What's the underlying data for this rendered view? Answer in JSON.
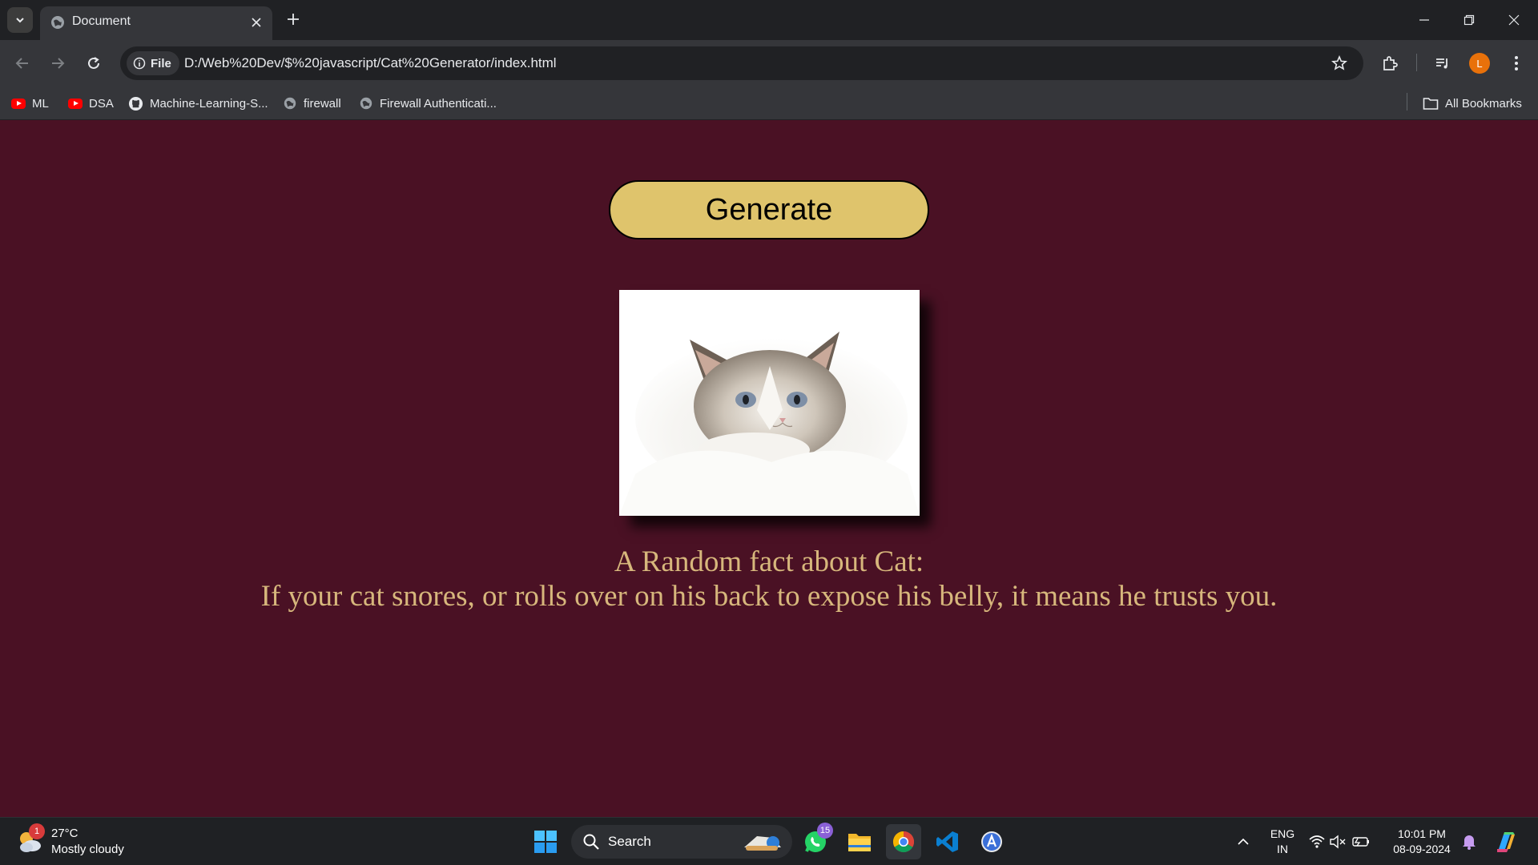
{
  "browser": {
    "tab_title": "Document",
    "chip_label": "File",
    "url": "D:/Web%20Dev/$%20javascript/Cat%20Generator/index.html",
    "profile_initial": "L",
    "bookmarks": [
      {
        "label": "ML",
        "icon": "youtube-icon"
      },
      {
        "label": "DSA",
        "icon": "youtube-icon"
      },
      {
        "label": "Machine-Learning-S...",
        "icon": "github-icon"
      },
      {
        "label": "firewall",
        "icon": "globe-icon"
      },
      {
        "label": "Firewall Authenticati...",
        "icon": "globe-icon"
      }
    ],
    "all_bookmarks_label": "All Bookmarks"
  },
  "page": {
    "generate_label": "Generate",
    "fact_heading": "A Random fact about Cat:",
    "fact_text": "If your cat snores, or rolls over on his back to expose his belly, it means he trusts you.",
    "colors": {
      "background": "#4a1124",
      "button": "#dfc46c",
      "text": "#d7b77c"
    }
  },
  "taskbar": {
    "weather_temp": "27°C",
    "weather_cond": "Mostly cloudy",
    "weather_badge": "1",
    "search_label": "Search",
    "whatsapp_badge": "15",
    "lang_top": "ENG",
    "lang_bottom": "IN",
    "time": "10:01 PM",
    "date": "08-09-2024"
  }
}
